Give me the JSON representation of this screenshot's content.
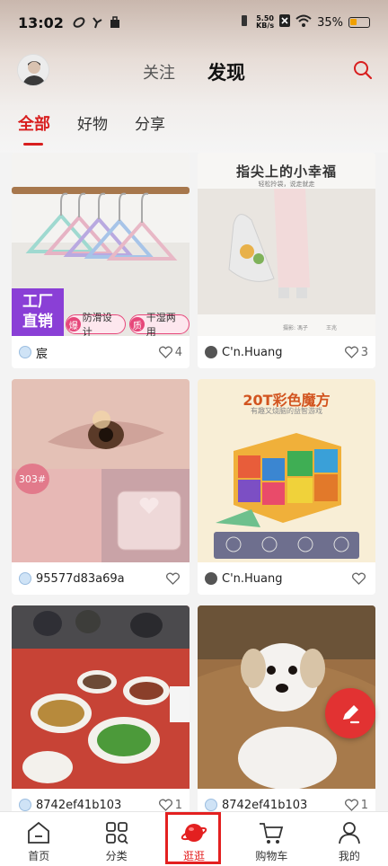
{
  "status_bar": {
    "time": "13:02",
    "net_speed_value": "5.50",
    "net_speed_unit": "KB/s",
    "battery": "35%"
  },
  "header": {
    "tabs": [
      {
        "label": "关注",
        "active": false
      },
      {
        "label": "发现",
        "active": true
      }
    ]
  },
  "subtabs": [
    {
      "label": "全部",
      "active": true
    },
    {
      "label": "好物",
      "active": false
    },
    {
      "label": "分享",
      "active": false
    }
  ],
  "cards": [
    {
      "user": "宸",
      "likes": "4",
      "image_text": {
        "badge_line1": "工厂",
        "badge_line2": "直销",
        "tag1_icon": "爆",
        "tag1": "防滑设计",
        "tag2_icon": "质",
        "tag2": "干湿两用"
      }
    },
    {
      "user": "C'n.Huang",
      "likes": "3",
      "image_text": {
        "title": "指尖上的小幸福",
        "subtitle": "轻松拎袋，说走就走",
        "footer_left": "摄影: 馮子",
        "footer_right": "王兆"
      }
    },
    {
      "user": "95577d83a69a",
      "likes": "",
      "image_text": {
        "badge": "303#"
      }
    },
    {
      "user": "C'n.Huang",
      "likes": "",
      "image_text": {
        "title": "20T彩色魔方",
        "subtitle": "有趣又烧脑的益智游戏"
      }
    },
    {
      "user": "8742ef41b103",
      "likes": "1"
    },
    {
      "user": "8742ef41b103",
      "likes": "1"
    }
  ],
  "tabbar": [
    {
      "label": "首页",
      "icon": "home-icon"
    },
    {
      "label": "分类",
      "icon": "category-icon"
    },
    {
      "label": "逛逛",
      "icon": "planet-icon",
      "active": true
    },
    {
      "label": "购物车",
      "icon": "cart-icon"
    },
    {
      "label": "我的",
      "icon": "profile-icon"
    }
  ],
  "colors": {
    "accent": "#d81e1e",
    "fab": "#e23232"
  }
}
